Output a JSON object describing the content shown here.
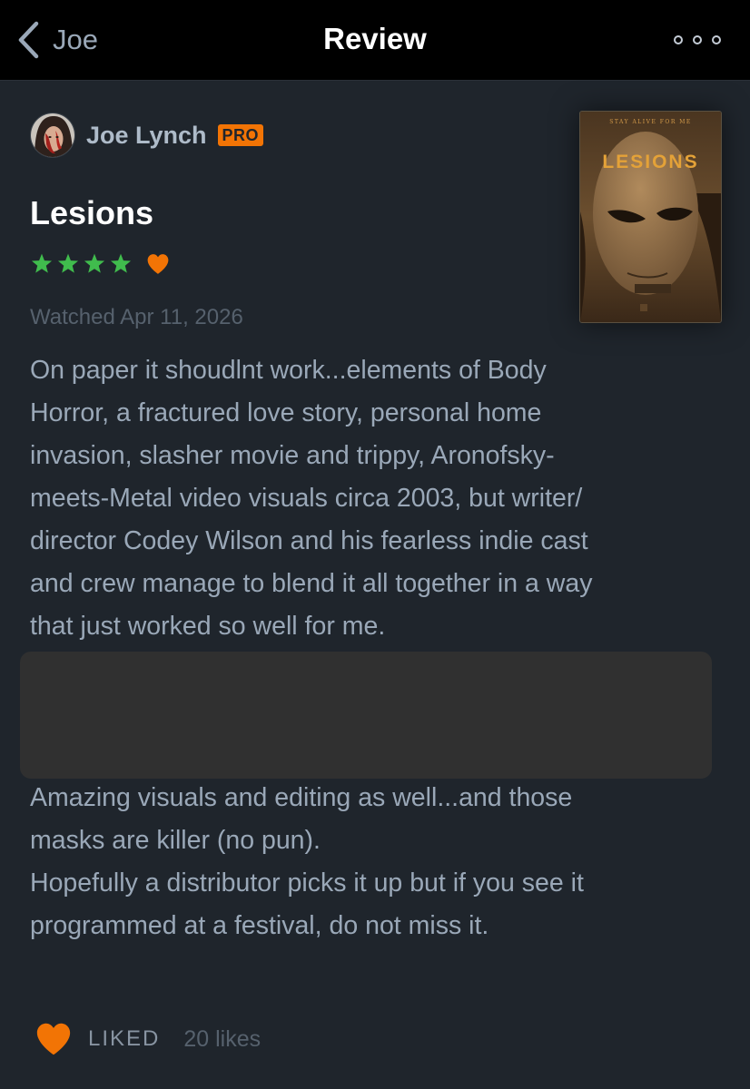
{
  "nav": {
    "back_label": "Joe",
    "title": "Review"
  },
  "author": {
    "name": "Joe Lynch",
    "badge": "PRO"
  },
  "film": {
    "title": "Lesions",
    "rating_stars": 4,
    "liked_heart": true,
    "watched": "Watched Apr 11, 2026",
    "poster": {
      "tagline": "STAY ALIVE FOR ME",
      "title": "LESIONS"
    }
  },
  "review": {
    "paragraph1_lines": [
      "On paper it shoudlnt work...elements of Body",
      "Horror, a fractured love story, personal home",
      "invasion, slasher movie and trippy, Aronofsky-",
      "meets-Metal video visuals circa 2003, but writer/",
      "director Codey Wilson and his fearless indie cast",
      "and crew manage to blend it all together in a way",
      "that just worked so well for me."
    ],
    "paragraph2_lines": [
      "Amazing visuals and editing as well...and those",
      "masks are killer (no pun).",
      "Hopefully a distributor picks it up but if you see it",
      "programmed at a festival, do not miss it."
    ]
  },
  "footer": {
    "liked_label": "LIKED",
    "likes_count": "20 likes"
  },
  "colors": {
    "background": "#1f252c",
    "topbar": "#000000",
    "star_green": "#40bc4d",
    "heart_orange": "#f27405",
    "pro_badge": "#f27405",
    "body_text": "#9aa8b8",
    "muted_text": "#56616d"
  },
  "icons": {
    "back": "chevron-left-icon",
    "more": "ellipsis-icon",
    "star": "star-icon",
    "heart": "heart-icon"
  }
}
